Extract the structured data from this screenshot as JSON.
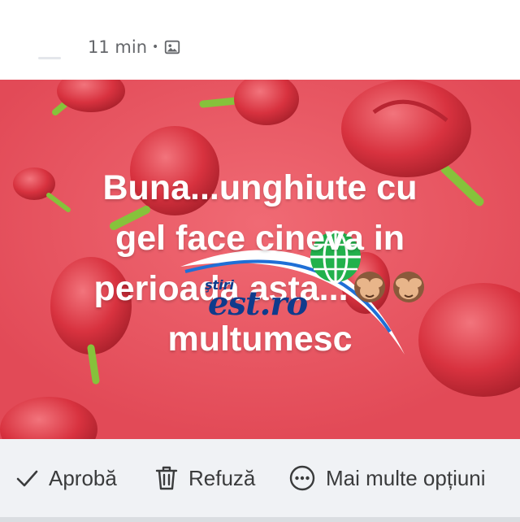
{
  "post": {
    "time": "11 min",
    "separator": "•",
    "audience_icon": "photo-album-icon",
    "image": {
      "background_color": "#e9505d",
      "text_lines": [
        "Buna...unghiute cu",
        "gel face cineva in",
        "perioada asta...",
        "multumesc"
      ],
      "emoji": "see-no-evil-monkey-icon",
      "watermark_small": "ştiri",
      "watermark_main": "est.ro"
    }
  },
  "actions": {
    "approve": {
      "label": "Aprobă",
      "icon": "checkmark-icon"
    },
    "decline": {
      "label": "Refuză",
      "icon": "trash-icon"
    },
    "more": {
      "label": "Mai multe opțiuni",
      "icon": "more-options-icon"
    }
  },
  "colors": {
    "text_secondary": "#65676b",
    "action_bar": "#f0f2f5",
    "watermark_blue": "#0f3b8c",
    "watermark_green": "#22b14c"
  }
}
